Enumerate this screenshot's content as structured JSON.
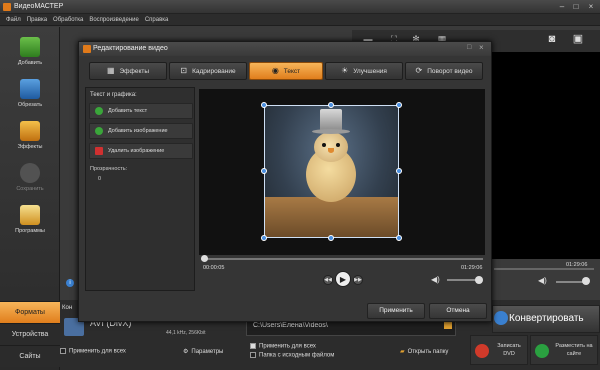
{
  "app": {
    "title": "ВидеоМАСТЕР"
  },
  "menu": [
    "Файл",
    "Правка",
    "Обработка",
    "Воспроизведение",
    "Справка"
  ],
  "sidebar": {
    "items": [
      {
        "label": "Добавить",
        "icon": "add-video-icon"
      },
      {
        "label": "Обрезать",
        "icon": "crop-icon"
      },
      {
        "label": "Эффекты",
        "icon": "effects-icon"
      },
      {
        "label": "Сохранить",
        "icon": "save-icon"
      },
      {
        "label": "Программы",
        "icon": "programs-icon"
      }
    ],
    "tabs": [
      "Форматы",
      "Устройства",
      "Сайты"
    ]
  },
  "dialog": {
    "title": "Редактирование видео",
    "tabs": [
      {
        "label": "Эффекты",
        "active": false
      },
      {
        "label": "Кадрирование",
        "active": false
      },
      {
        "label": "Текст",
        "active": true
      },
      {
        "label": "Улучшения",
        "active": false
      },
      {
        "label": "Поворот видео",
        "active": false
      }
    ],
    "panel": {
      "heading": "Текст и графика:",
      "add_text": "Добавить текст",
      "add_image": "Добавить изображение",
      "remove_image": "Удалить изображение",
      "transparency_label": "Прозрачность:",
      "transparency_value": "0"
    },
    "time_start": "00:00:05",
    "time_end": "01:29:06",
    "apply": "Применить",
    "cancel": "Отмена"
  },
  "right": {
    "time": "01:29:06"
  },
  "bottom": {
    "format_label": "AVI (DivX)",
    "format_details": "44,1 kHz, 256Kbit",
    "apply_all": "Применить для всех",
    "params": "Параметры",
    "path": "C:\\Users\\Елена\\Videos\\",
    "apply_all2": "Применить для всех",
    "source_folder": "Папка с исходным файлом",
    "open_folder": "Открыть папку",
    "convert": "Конвертировать",
    "burn_dvd": "Записать DVD",
    "publish": "Разместить на сайте",
    "kon": "Кон"
  },
  "colors": {
    "accent": "#f0a040",
    "handle": "#4a8fe0"
  }
}
